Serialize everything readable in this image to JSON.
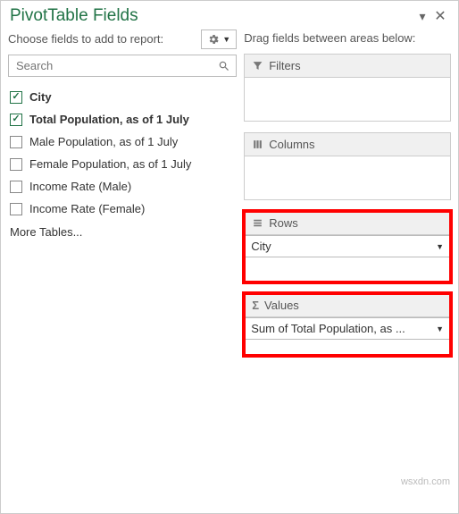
{
  "header": {
    "title": "PivotTable Fields"
  },
  "left": {
    "choose_label": "Choose fields to add to report:",
    "search_placeholder": "Search",
    "fields": [
      {
        "label": "City",
        "checked": true
      },
      {
        "label": "Total Population, as of 1 July",
        "checked": true
      },
      {
        "label": "Male Population, as of 1 July",
        "checked": false
      },
      {
        "label": "Female Population, as of 1 July",
        "checked": false
      },
      {
        "label": "Income Rate (Male)",
        "checked": false
      },
      {
        "label": "Income Rate (Female)",
        "checked": false
      }
    ],
    "more_tables": "More Tables..."
  },
  "right": {
    "drag_label": "Drag fields between areas below:",
    "areas": {
      "filters": {
        "title": "Filters",
        "items": []
      },
      "columns": {
        "title": "Columns",
        "items": []
      },
      "rows": {
        "title": "Rows",
        "items": [
          "City"
        ]
      },
      "values": {
        "title": "Values",
        "items": [
          "Sum of Total Population, as ..."
        ]
      }
    }
  },
  "watermark": "wsxdn.com"
}
